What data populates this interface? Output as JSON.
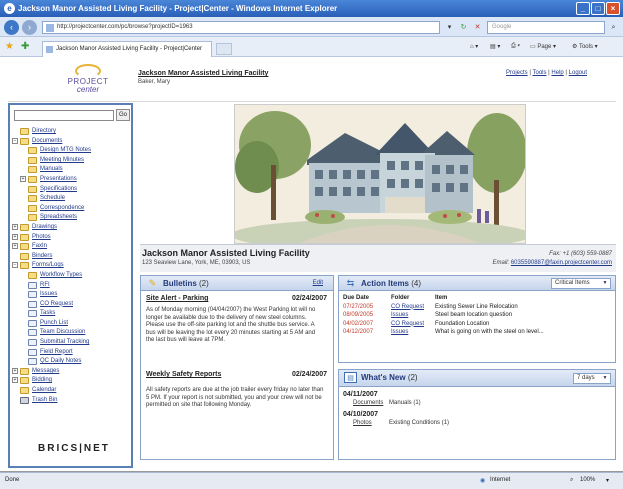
{
  "browser": {
    "title": "Jackson Manor Assisted Living Facility - Project|Center - Windows Internet Explorer",
    "address": "http://projectcenter.com/pc/browse?projectID=1963",
    "search_placeholder": "Google",
    "tab_label": "Jackson Manor Assisted Living Facility - Project|Center",
    "tools": {
      "page": "Page",
      "tools": "Tools"
    },
    "status": {
      "left": "Done",
      "zone": "Internet",
      "zoom": "100%"
    }
  },
  "header": {
    "logo_line1": "PROJECT",
    "logo_line2": "center",
    "project_title": "Jackson Manor Assisted Living Facility",
    "user": "Baker, Mary",
    "links": [
      "Projects",
      "Tools",
      "Help",
      "Logout"
    ],
    "link_sep": " | "
  },
  "sidebar": {
    "go_label": "Go",
    "brand": "BRICS|NET",
    "tree": [
      {
        "label": "Directory",
        "level": 0,
        "toggle": "",
        "icon": "directory-icon"
      },
      {
        "label": "Documents",
        "level": 0,
        "toggle": "−",
        "icon": "folder-icon"
      },
      {
        "label": "Design MTG Notes",
        "level": 1,
        "toggle": "",
        "icon": "folder-icon"
      },
      {
        "label": "Meeting Minutes",
        "level": 1,
        "toggle": "",
        "icon": "folder-icon"
      },
      {
        "label": "Manuals",
        "level": 1,
        "toggle": "",
        "icon": "folder-icon"
      },
      {
        "label": "Presentations",
        "level": 1,
        "toggle": "+",
        "icon": "folder-icon"
      },
      {
        "label": "Specifications",
        "level": 1,
        "toggle": "",
        "icon": "folder-icon"
      },
      {
        "label": "Schedule",
        "level": 1,
        "toggle": "",
        "icon": "folder-icon"
      },
      {
        "label": "Correspondence",
        "level": 1,
        "toggle": "",
        "icon": "folder-icon"
      },
      {
        "label": "Spreadsheets",
        "level": 1,
        "toggle": "",
        "icon": "folder-icon"
      },
      {
        "label": "Drawings",
        "level": 0,
        "toggle": "+",
        "icon": "folder-icon"
      },
      {
        "label": "Photos",
        "level": 0,
        "toggle": "+",
        "icon": "folder-icon"
      },
      {
        "label": "FaxIn",
        "level": 0,
        "toggle": "+",
        "icon": "folder-icon"
      },
      {
        "label": "Binders",
        "level": 0,
        "toggle": "",
        "icon": "folder-icon"
      },
      {
        "label": "Forms/Logs",
        "level": 0,
        "toggle": "−",
        "icon": "folder-icon"
      },
      {
        "label": "Workflow Types",
        "level": 1,
        "toggle": "",
        "icon": "folder-icon"
      },
      {
        "label": "RFI",
        "level": 1,
        "toggle": "",
        "icon": "form-icon"
      },
      {
        "label": "Issues",
        "level": 1,
        "toggle": "",
        "icon": "form-icon"
      },
      {
        "label": "CO Request",
        "level": 1,
        "toggle": "",
        "icon": "form-icon"
      },
      {
        "label": "Tasks",
        "level": 1,
        "toggle": "",
        "icon": "form-icon"
      },
      {
        "label": "Punch List",
        "level": 1,
        "toggle": "",
        "icon": "form-icon"
      },
      {
        "label": "Team Discussion",
        "level": 1,
        "toggle": "",
        "icon": "form-icon"
      },
      {
        "label": "Submittal Tracking",
        "level": 1,
        "toggle": "",
        "icon": "form-icon"
      },
      {
        "label": "Field Report",
        "level": 1,
        "toggle": "",
        "icon": "form-icon"
      },
      {
        "label": "QC Daily Notes",
        "level": 1,
        "toggle": "",
        "icon": "form-icon"
      },
      {
        "label": "Messages",
        "level": 0,
        "toggle": "+",
        "icon": "folder-icon"
      },
      {
        "label": "Bidding",
        "level": 0,
        "toggle": "+",
        "icon": "folder-icon"
      },
      {
        "label": "Calendar",
        "level": 0,
        "toggle": "",
        "icon": "folder-icon"
      },
      {
        "label": "Trash Bin",
        "level": 0,
        "toggle": "",
        "icon": "trash-icon"
      }
    ]
  },
  "project": {
    "name": "Jackson Manor Assisted Living Facility",
    "address": "123 Seaview Lane, York, ME, 03903, US",
    "fax_label": "Fax:",
    "fax": "+1 (603) 559-0887",
    "email_label": "Email:",
    "email": "6035590887@faxin.projectcenter.com"
  },
  "bulletins": {
    "title": "Bulletins",
    "count": "(2)",
    "edit_label": "Edit",
    "items": [
      {
        "heading": "Site Alert - Parking",
        "date": "02/24/2007",
        "body": "As of Monday morning (04/04/2007) the West Parking lot will no longer be available due to the delivery of new steel columns. Please use the off-site parking lot and the shuttle bus service. A bus will be leaving the lot every 20 minutes starting at 5 AM and the last bus will leave at 7PM."
      },
      {
        "heading": "Weekly Safety Reports",
        "date": "02/24/2007",
        "body": "All safety reports are due at the job trailer every friday no later than 5 PM. If your report is not submitted, you and your crew will not be permitted on site that following Monday."
      }
    ]
  },
  "action_items": {
    "title": "Action Items",
    "count": "(4)",
    "filter": "Critical Items",
    "columns": [
      "Due Date",
      "Folder",
      "Item"
    ],
    "rows": [
      {
        "due": "07/27/2005",
        "folder": "CO Request",
        "item": "Existing Sewer Line Relocation"
      },
      {
        "due": "08/09/2005",
        "folder": "Issues",
        "item": "Steel beam location question"
      },
      {
        "due": "04/02/2007",
        "folder": "CO Request",
        "item": "Foundation Location"
      },
      {
        "due": "04/12/2007",
        "folder": "Issues",
        "item": "What is going on with the steel on level..."
      }
    ]
  },
  "whats_new": {
    "title": "What's New",
    "count": "(2)",
    "filter": "7 days",
    "groups": [
      {
        "date": "04/11/2007",
        "folder": "Documents",
        "detail": "Manuals (1)"
      },
      {
        "date": "04/10/2007",
        "folder": "Photos",
        "detail": "Existing Conditions (1)"
      }
    ]
  },
  "colors": {
    "overdue": "#c0392b",
    "panel_header": "#c6d5ec",
    "link": "#223a8a"
  }
}
